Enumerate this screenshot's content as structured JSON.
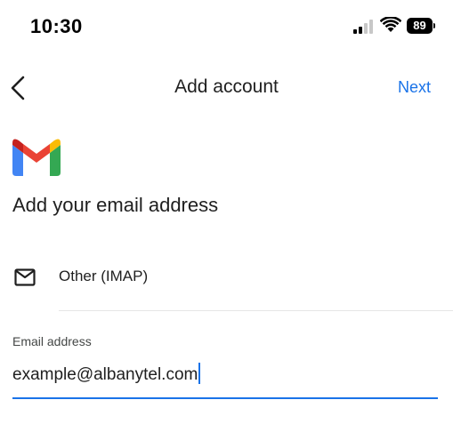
{
  "status_bar": {
    "time": "10:30",
    "battery_level": "89",
    "icons": [
      "signal-icon",
      "wifi-icon",
      "battery-icon"
    ]
  },
  "header": {
    "back_icon": "chevron-left-icon",
    "title": "Add account",
    "next_label": "Next"
  },
  "main": {
    "logo": "gmail-logo",
    "heading": "Add your email address",
    "account_type": {
      "icon": "mail-icon",
      "label": "Other (IMAP)"
    },
    "email_field": {
      "label": "Email address",
      "value": "example@albanytel.com"
    }
  },
  "colors": {
    "accent": "#1a73e8",
    "text": "#1f1f1f",
    "gmail_red": "#ea4335",
    "gmail_blue": "#4285f4",
    "gmail_green": "#34a853",
    "gmail_yellow": "#fbbc04",
    "gmail_dark_red": "#c5221f"
  }
}
